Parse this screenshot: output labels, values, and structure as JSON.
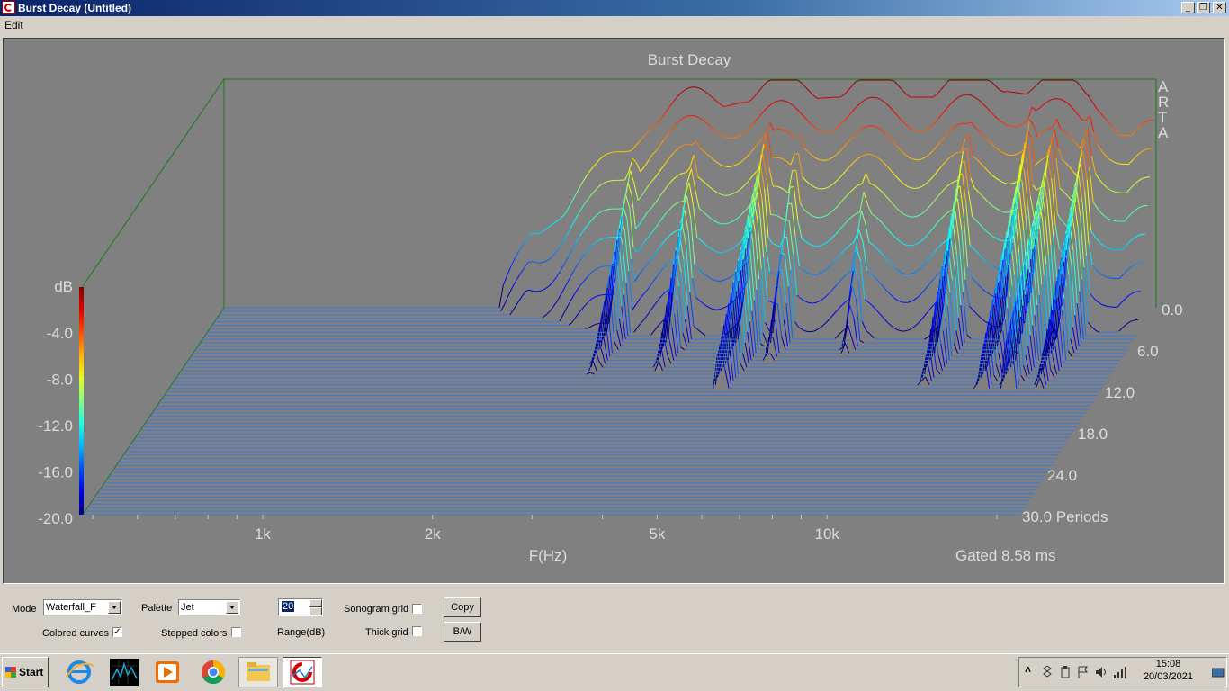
{
  "window": {
    "title": "Burst Decay  (Untitled)",
    "buttons": {
      "minimize": "_",
      "restore": "❐",
      "close": "✕"
    }
  },
  "menu": {
    "edit": "Edit"
  },
  "plot": {
    "title": "Burst Decay",
    "watermark": [
      "A",
      "R",
      "T",
      "A"
    ],
    "db_unit": "dB",
    "db_ticks": [
      "-4.0",
      "-8.0",
      "-12.0",
      "-16.0",
      "-20.0"
    ],
    "freq_ticks": [
      "1k",
      "2k",
      "5k",
      "10k"
    ],
    "x_label": "F(Hz)",
    "period_ticks": [
      "0.0",
      "6.0",
      "12.0",
      "18.0",
      "24.0",
      "30.0 Periods"
    ],
    "gate_text": "Gated 8.58 ms",
    "colors": {
      "background": "#808080",
      "axes": "#1a7a1a",
      "floor": "#3c78d8"
    }
  },
  "chart_data": {
    "type": "waterfall",
    "title": "Burst Decay",
    "xlabel": "F(Hz)",
    "ylabel": "dB",
    "zlabel": "Periods",
    "x_scale": "log",
    "x_ticks": [
      "1k",
      "2k",
      "5k",
      "10k"
    ],
    "ylim": [
      -20,
      0
    ],
    "zlim": [
      0,
      30
    ],
    "palette": "Jet",
    "range_db": 20,
    "first_slice_envelope_db": [
      {
        "f": 1500,
        "db": -20
      },
      {
        "f": 1700,
        "db": -13
      },
      {
        "f": 2200,
        "db": -9
      },
      {
        "f": 2800,
        "db": -3
      },
      {
        "f": 4000,
        "db": -1
      },
      {
        "f": 6000,
        "db": -0.5
      },
      {
        "f": 9000,
        "db": -0.5
      },
      {
        "f": 12000,
        "db": 0
      },
      {
        "f": 17000,
        "db": -1
      },
      {
        "f": 20000,
        "db": -5
      }
    ]
  },
  "controls": {
    "mode_label": "Mode",
    "mode_value": "Waterfall_F",
    "palette_label": "Palette",
    "palette_value": "Jet",
    "range_value": "20",
    "range_label": "Range(dB)",
    "sonogram_grid_label": "Sonogram grid",
    "colored_curves_label": "Colored curves",
    "colored_curves_checked": true,
    "stepped_colors_label": "Stepped colors",
    "stepped_colors_checked": false,
    "thick_grid_label": "Thick grid",
    "thick_grid_checked": false,
    "sonogram_grid_checked": false,
    "copy_label": "Copy",
    "bw_label": "B/W"
  },
  "taskbar": {
    "start_label": "Start",
    "apps": [
      "internet-explorer-icon",
      "spectrum-app-icon",
      "media-player-icon",
      "chrome-icon",
      "file-explorer-icon",
      "arta-icon"
    ],
    "tray_chevron": "˄",
    "time": "15:08",
    "date": "20/03/2021"
  }
}
